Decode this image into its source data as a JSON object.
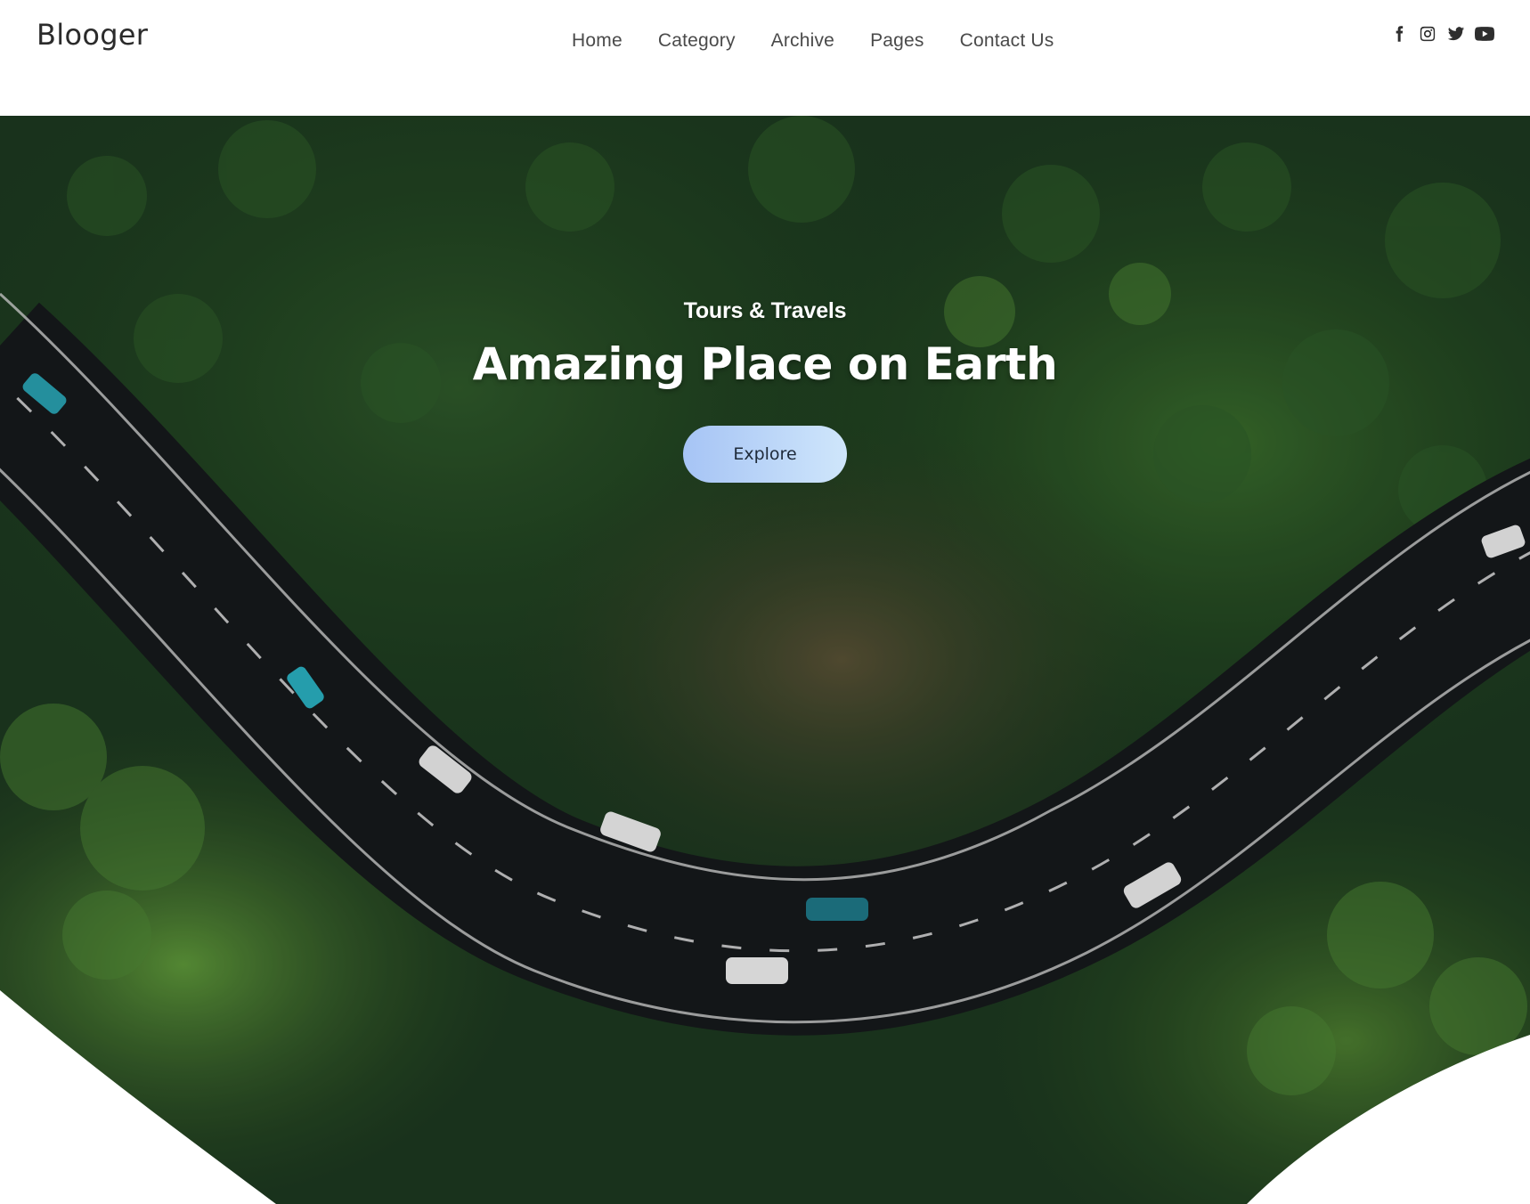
{
  "header": {
    "logo": "Blooger",
    "nav": [
      "Home",
      "Category",
      "Archive",
      "Pages",
      "Contact Us"
    ],
    "social": [
      "facebook-icon",
      "instagram-icon",
      "twitter-icon",
      "youtube-icon"
    ]
  },
  "hero": {
    "kicker": "Tours & Travels",
    "title": "Amazing Place on Earth",
    "cta": "Explore",
    "cta_colors": [
      "#a6c4f5",
      "#cfe6fb"
    ],
    "background": "aerial photo of a winding road through a forest"
  }
}
